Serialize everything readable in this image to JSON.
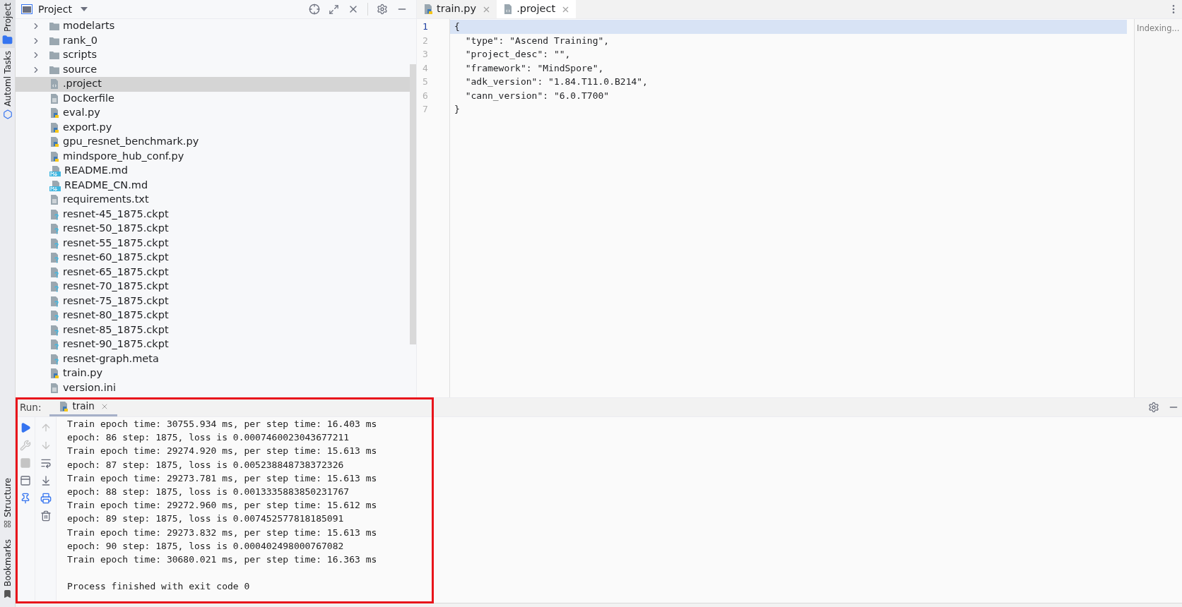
{
  "side_strip": {
    "top": [
      {
        "label": "Project",
        "selected": true
      },
      {
        "label": "Automl Tasks",
        "selected": false
      }
    ],
    "bottom": [
      {
        "label": "Structure"
      },
      {
        "label": "Bookmarks"
      }
    ]
  },
  "project_panel": {
    "title": "Project",
    "tree": [
      {
        "name": "modelarts",
        "kind": "folder",
        "expanded": false,
        "selected": false
      },
      {
        "name": "rank_0",
        "kind": "folder",
        "expanded": false,
        "selected": false
      },
      {
        "name": "scripts",
        "kind": "folder",
        "expanded": false,
        "selected": false
      },
      {
        "name": "source",
        "kind": "folder",
        "expanded": false,
        "selected": false
      },
      {
        "name": ".project",
        "kind": "json",
        "selected": true
      },
      {
        "name": "Dockerfile",
        "kind": "text",
        "selected": false
      },
      {
        "name": "eval.py",
        "kind": "python",
        "selected": false
      },
      {
        "name": "export.py",
        "kind": "python",
        "selected": false
      },
      {
        "name": "gpu_resnet_benchmark.py",
        "kind": "python",
        "selected": false
      },
      {
        "name": "mindspore_hub_conf.py",
        "kind": "python",
        "selected": false
      },
      {
        "name": "README.md",
        "kind": "markdown",
        "selected": false
      },
      {
        "name": "README_CN.md",
        "kind": "markdown",
        "selected": false
      },
      {
        "name": "requirements.txt",
        "kind": "text",
        "selected": false
      },
      {
        "name": "resnet-45_1875.ckpt",
        "kind": "unknown",
        "selected": false
      },
      {
        "name": "resnet-50_1875.ckpt",
        "kind": "unknown",
        "selected": false
      },
      {
        "name": "resnet-55_1875.ckpt",
        "kind": "unknown",
        "selected": false
      },
      {
        "name": "resnet-60_1875.ckpt",
        "kind": "unknown",
        "selected": false
      },
      {
        "name": "resnet-65_1875.ckpt",
        "kind": "unknown",
        "selected": false
      },
      {
        "name": "resnet-70_1875.ckpt",
        "kind": "unknown",
        "selected": false
      },
      {
        "name": "resnet-75_1875.ckpt",
        "kind": "unknown",
        "selected": false
      },
      {
        "name": "resnet-80_1875.ckpt",
        "kind": "unknown",
        "selected": false
      },
      {
        "name": "resnet-85_1875.ckpt",
        "kind": "unknown",
        "selected": false
      },
      {
        "name": "resnet-90_1875.ckpt",
        "kind": "unknown",
        "selected": false
      },
      {
        "name": "resnet-graph.meta",
        "kind": "unknown",
        "selected": false
      },
      {
        "name": "train.py",
        "kind": "python",
        "selected": false
      },
      {
        "name": "version.ini",
        "kind": "text",
        "selected": false
      }
    ]
  },
  "editor": {
    "tabs": [
      {
        "label": "train.py",
        "kind": "python",
        "selected": false
      },
      {
        "label": ".project",
        "kind": "json",
        "selected": true
      }
    ],
    "status": "Indexing...",
    "lines": [
      {
        "number": "1",
        "text": "{",
        "current": true
      },
      {
        "number": "2",
        "text": "  \"type\": \"Ascend Training\",",
        "current": false
      },
      {
        "number": "3",
        "text": "  \"project_desc\": \"\",",
        "current": false
      },
      {
        "number": "4",
        "text": "  \"framework\": \"MindSpore\",",
        "current": false
      },
      {
        "number": "5",
        "text": "  \"adk_version\": \"1.84.T11.0.B214\",",
        "current": false
      },
      {
        "number": "6",
        "text": "  \"cann_version\": \"6.0.T700\"",
        "current": false
      },
      {
        "number": "7",
        "text": "}",
        "current": false
      }
    ]
  },
  "run_panel": {
    "label": "Run:",
    "tabs": [
      {
        "label": "train",
        "selected": true
      }
    ],
    "toolbar_left": [
      {
        "kind": "run",
        "disabled": false
      },
      {
        "kind": "wrench",
        "disabled": true
      },
      {
        "kind": "stop",
        "disabled": true
      },
      {
        "kind": "layout",
        "disabled": false
      },
      {
        "kind": "pin",
        "disabled": false
      }
    ],
    "toolbar_right": [
      {
        "kind": "up",
        "disabled": true
      },
      {
        "kind": "down",
        "disabled": true
      },
      {
        "kind": "wrap",
        "disabled": false
      },
      {
        "kind": "scroll-end",
        "disabled": false
      },
      {
        "kind": "print",
        "disabled": false
      },
      {
        "kind": "trash",
        "disabled": false
      }
    ],
    "output": [
      "Train epoch time: 30755.934 ms, per step time: 16.403 ms",
      "epoch: 86 step: 1875, loss is 0.0007460023043677211",
      "Train epoch time: 29274.920 ms, per step time: 15.613 ms",
      "epoch: 87 step: 1875, loss is 0.005238848738372326",
      "Train epoch time: 29273.781 ms, per step time: 15.613 ms",
      "epoch: 88 step: 1875, loss is 0.0013335883850231767",
      "Train epoch time: 29272.960 ms, per step time: 15.612 ms",
      "epoch: 89 step: 1875, loss is 0.007452577818185091",
      "Train epoch time: 29273.832 ms, per step time: 15.613 ms",
      "epoch: 90 step: 1875, loss is 0.000402498000767082",
      "Train epoch time: 30680.021 ms, per step time: 16.363 ms"
    ],
    "exit_message": "Process finished with exit code 0"
  }
}
